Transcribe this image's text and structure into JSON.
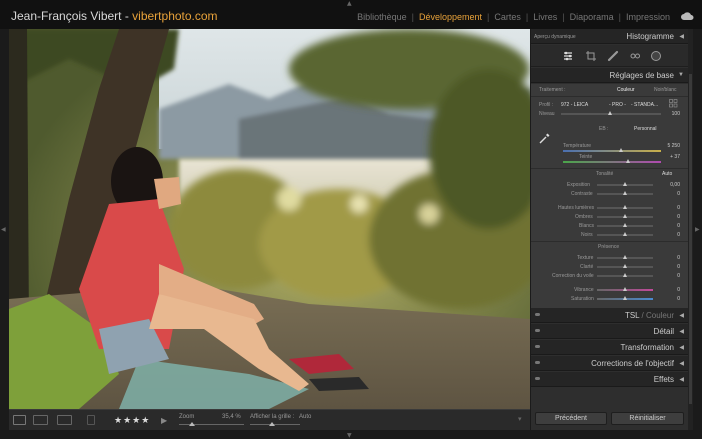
{
  "header": {
    "identity_name": "Jean-François Vibert - ",
    "identity_site": "vibertphoto.com",
    "modules": [
      {
        "label": "Bibliothèque",
        "active": false
      },
      {
        "label": "Développement",
        "active": true
      },
      {
        "label": "Cartes",
        "active": false
      },
      {
        "label": "Livres",
        "active": false
      },
      {
        "label": "Diaporama",
        "active": false
      },
      {
        "label": "Impression",
        "active": false
      }
    ]
  },
  "toolbar": {
    "stars": "★★★★",
    "zoom_label": "Zoom",
    "zoom_value": "35,4 %",
    "grid_label": "Afficher la grille :",
    "grid_value": "Auto"
  },
  "panel": {
    "apercu_left": "Aperçu dynamique",
    "histogram": "Histogramme",
    "basic": "Réglages de base",
    "treatment_label": "Traitement :",
    "treatment_color": "Couleur",
    "treatment_bw": "Noir/blanc",
    "profile_label": "Profil :",
    "profile_value": "972 - LEICA",
    "profile_mid": "- PRO -",
    "profile_std": "- STANDA...",
    "amount_label": "Niveau",
    "amount_value": "100",
    "wb_label": "EB :",
    "wb_value": "Personnal",
    "temp_label": "Température",
    "temp_value": "5 250",
    "tint_label": "Teinte",
    "tint_value": "+ 37",
    "tone_label": "Tonalité",
    "tone_auto": "Auto",
    "exposure_label": "Exposition",
    "exposure_value": "0,00",
    "contrast_label": "Contraste",
    "contrast_value": "0",
    "highlights_label": "Hautes lumières",
    "highlights_value": "0",
    "shadows_label": "Ombres",
    "shadows_value": "0",
    "whites_label": "Blancs",
    "whites_value": "0",
    "blacks_label": "Noirs",
    "blacks_value": "0",
    "presence_label": "Présence",
    "texture_label": "Texture",
    "texture_value": "0",
    "clarity_label": "Clarté",
    "clarity_value": "0",
    "dehaze_label": "Correction du voile",
    "dehaze_value": "0",
    "vibrance_label": "Vibrance",
    "vibrance_value": "0",
    "saturation_label": "Saturation",
    "saturation_value": "0",
    "hsl": "TSL",
    "hsl_color": " / Couleur",
    "detail": "Détail",
    "transform": "Transformation",
    "lens": "Corrections de l'objectif",
    "effects": "Effets",
    "previous_button": "Précédent",
    "reset_button": "Réinitialiser"
  },
  "colors": {
    "accent": "#e8a23a",
    "panel_bg": "#2e2e2e",
    "header_bg": "#252525"
  }
}
